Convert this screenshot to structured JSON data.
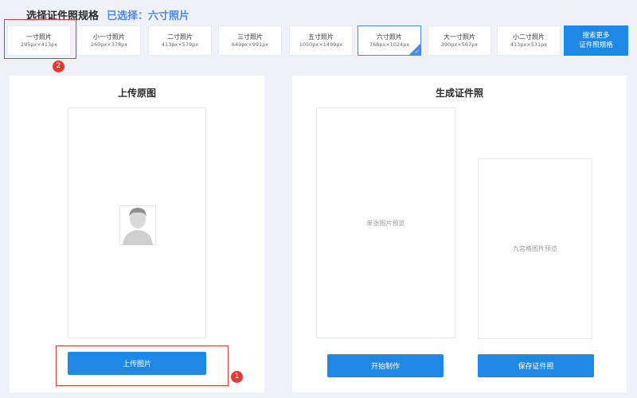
{
  "header": {
    "title": "选择证件照规格",
    "selected_label": "已选择：六寸照片"
  },
  "sizes": [
    {
      "name": "一寸照片",
      "px": "295px×413px"
    },
    {
      "name": "小一寸照片",
      "px": "260px×378px"
    },
    {
      "name": "二寸照片",
      "px": "413px×579px"
    },
    {
      "name": "三寸照片",
      "px": "649px×991px"
    },
    {
      "name": "五寸照片",
      "px": "1050px×1499px"
    },
    {
      "name": "六寸照片",
      "px": "768px×1024px",
      "selected": true
    },
    {
      "name": "大一寸照片",
      "px": "390px×567px"
    },
    {
      "name": "小二寸照片",
      "px": "413px×531px"
    }
  ],
  "search_more": {
    "line1": "搜索更多",
    "line2": "证件照规格"
  },
  "upload_panel": {
    "title": "上传原图",
    "button": "上传图片"
  },
  "generate_panel": {
    "title": "生成证件照",
    "single_preview": "单张图片预览",
    "grid_preview": "九宫格图片预览",
    "start_button": "开始制作",
    "save_button": "保存证件照"
  },
  "annotations": [
    "1",
    "2"
  ],
  "colors": {
    "accent": "#1e88e5",
    "annotation": "#e53935",
    "selected_text": "#4c88e8"
  }
}
